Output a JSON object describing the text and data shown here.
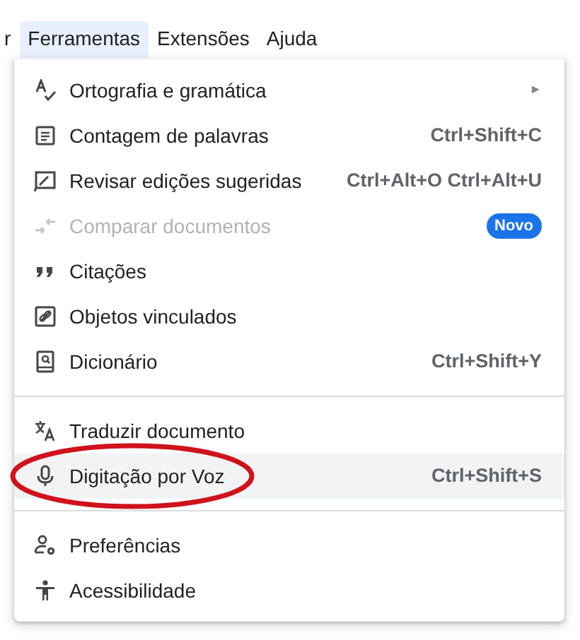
{
  "menu_bar": [
    {
      "label": "r",
      "selected": false
    },
    {
      "label": "Ferramentas",
      "selected": true
    },
    {
      "label": "Extensões",
      "selected": false
    },
    {
      "label": "Ajuda",
      "selected": false
    }
  ],
  "menu": {
    "items": [
      {
        "kind": "item",
        "label": "Ortografia e gramática",
        "submenu": true,
        "submenu_arrow": "►",
        "disabled": false,
        "highlighted": false,
        "circled": false
      },
      {
        "kind": "item",
        "label": "Contagem de palavras",
        "shortcut": "Ctrl+Shift+C",
        "disabled": false,
        "highlighted": false,
        "circled": false
      },
      {
        "kind": "item",
        "label": "Revisar edições sugeridas",
        "shortcut": "Ctrl+Alt+O Ctrl+Alt+U",
        "disabled": false,
        "highlighted": false,
        "circled": false
      },
      {
        "kind": "item",
        "label": "Comparar documentos",
        "badge": "Novo",
        "disabled": true,
        "highlighted": false,
        "circled": false
      },
      {
        "kind": "item",
        "label": "Citações",
        "disabled": false,
        "highlighted": false,
        "circled": false
      },
      {
        "kind": "item",
        "label": "Objetos vinculados",
        "disabled": false,
        "highlighted": false,
        "circled": false
      },
      {
        "kind": "item",
        "label": "Dicionário",
        "shortcut": "Ctrl+Shift+Y",
        "disabled": false,
        "highlighted": false,
        "circled": false
      },
      {
        "kind": "divider"
      },
      {
        "kind": "item",
        "label": "Traduzir documento",
        "disabled": false,
        "highlighted": false,
        "circled": false
      },
      {
        "kind": "item",
        "label": "Digitação por Voz",
        "shortcut": "Ctrl+Shift+S",
        "disabled": false,
        "highlighted": true,
        "circled": true
      },
      {
        "kind": "divider"
      },
      {
        "kind": "item",
        "label": "Preferências",
        "disabled": false,
        "highlighted": false,
        "circled": false
      },
      {
        "kind": "item",
        "label": "Acessibilidade",
        "disabled": false,
        "highlighted": false,
        "circled": false
      }
    ]
  }
}
